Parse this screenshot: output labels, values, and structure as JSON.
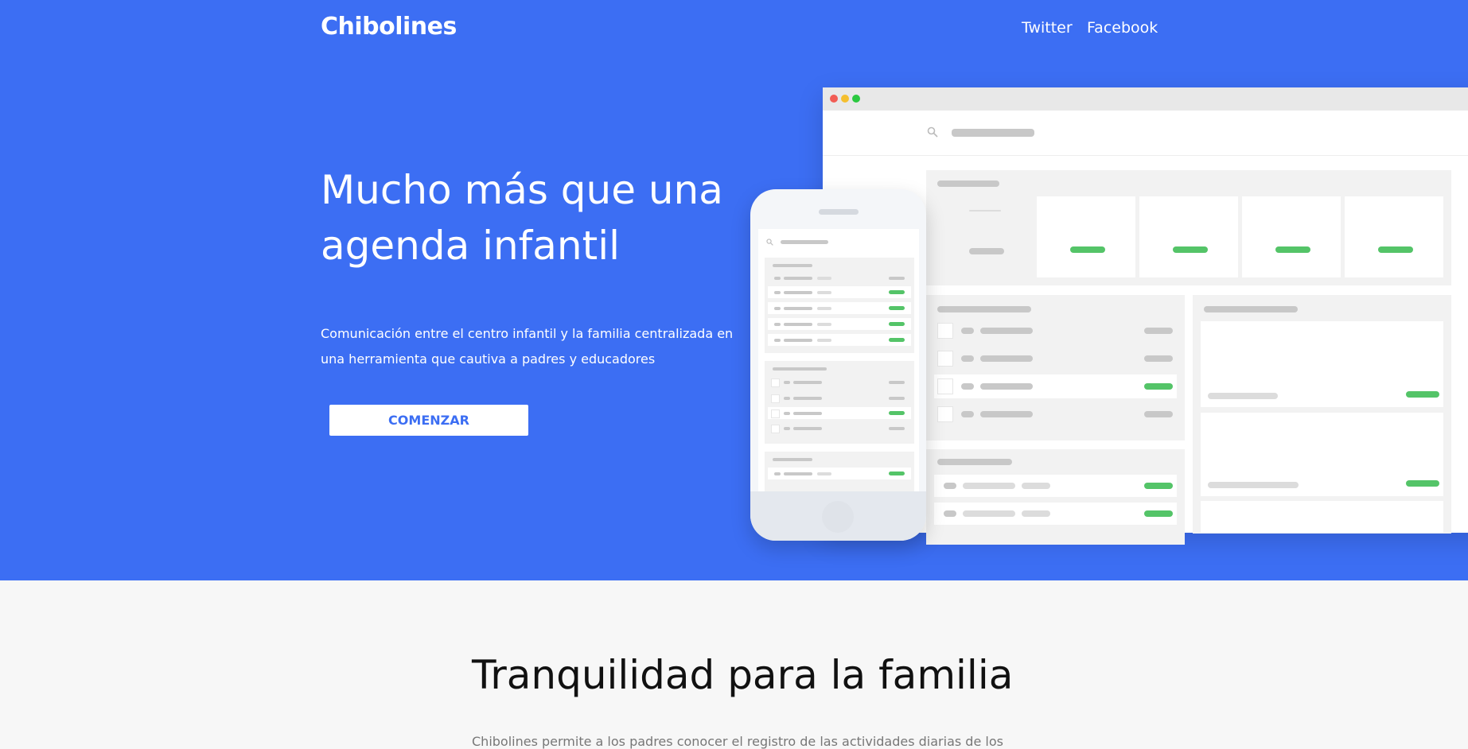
{
  "brand": "Chibolines",
  "nav": {
    "twitter": "Twitter",
    "facebook": "Facebook"
  },
  "hero": {
    "headline": "Mucho más que una agenda infantil",
    "subtitle": "Comunicación entre el centro infantil y la familia centralizada en una herramienta que cautiva a padres y educadores",
    "cta": "COMENZAR"
  },
  "section": {
    "title": "Tranquilidad para la familia",
    "text": "Chibolines permite a los padres conocer el registro de las actividades diarias de los"
  },
  "colors": {
    "hero_bg": "#3c6ef3",
    "accent_green": "#54c468",
    "page_bg": "#f7f7f7"
  },
  "icons": {
    "search": "search-icon"
  }
}
